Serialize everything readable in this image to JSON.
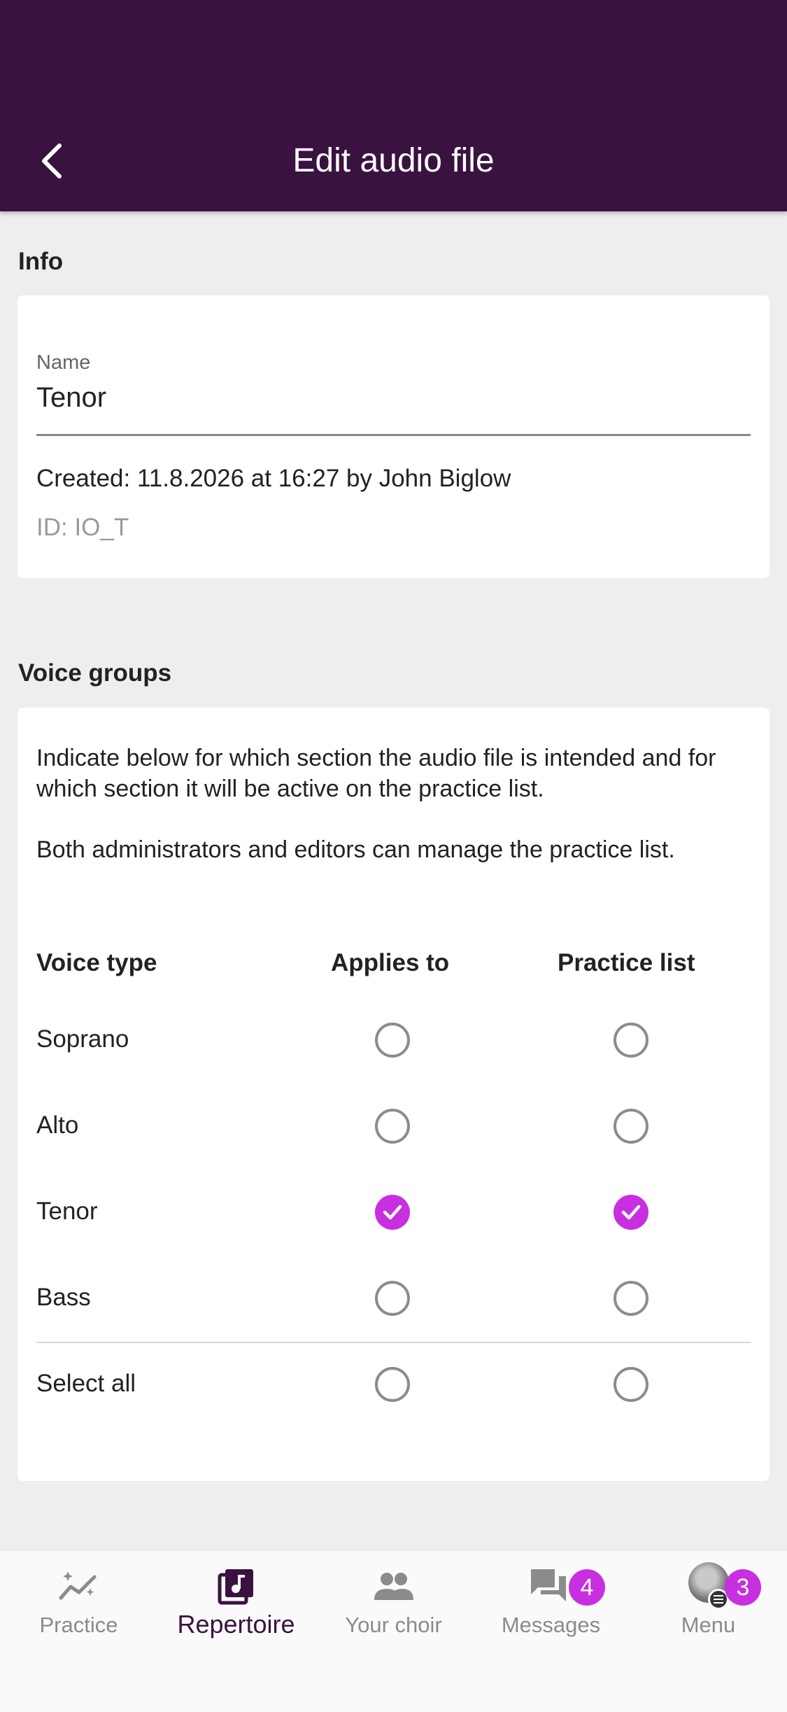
{
  "header": {
    "title": "Edit audio file",
    "back_icon": "chevron-left-icon"
  },
  "info": {
    "heading": "Info",
    "name_label": "Name",
    "name_value": "Tenor",
    "created": "Created: 11.8.2026 at 16:27 by John Biglow",
    "id": "ID: IO_T"
  },
  "voice_groups": {
    "heading": "Voice groups",
    "description_1": "Indicate below for which section the audio file is intended and for which section it will be active on the practice list.",
    "description_2": "Both administrators and editors can manage the practice list.",
    "columns": [
      "Voice type",
      "Applies to",
      "Practice list"
    ],
    "rows": [
      {
        "label": "Soprano",
        "applies": false,
        "practice": false
      },
      {
        "label": "Alto",
        "applies": false,
        "practice": false
      },
      {
        "label": "Tenor",
        "applies": true,
        "practice": true
      },
      {
        "label": "Bass",
        "applies": false,
        "practice": false
      }
    ],
    "select_all": {
      "label": "Select all",
      "applies": false,
      "practice": false
    }
  },
  "tabbar": {
    "tabs": [
      {
        "label": "Practice",
        "icon": "trending-sparkle-icon",
        "active": false
      },
      {
        "label": "Repertoire",
        "icon": "music-library-icon",
        "active": true
      },
      {
        "label": "Your choir",
        "icon": "people-icon",
        "active": false
      },
      {
        "label": "Messages",
        "icon": "chat-bubbles-icon",
        "active": false,
        "badge": "4"
      },
      {
        "label": "Menu",
        "icon": "avatar-menu-icon",
        "active": false,
        "badge": "3"
      }
    ]
  },
  "colors": {
    "header_bg": "#3a1240",
    "accent": "#c72fe0",
    "background": "#eeeeee"
  }
}
